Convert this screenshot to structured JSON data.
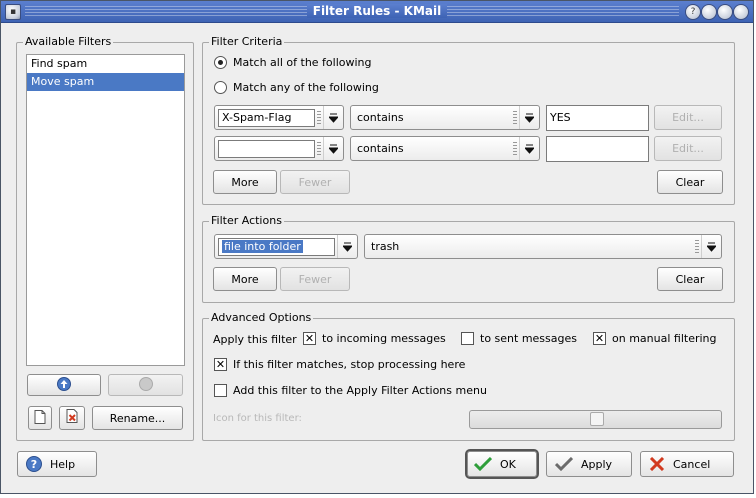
{
  "window": {
    "title": "Filter Rules - KMail"
  },
  "available_filters": {
    "label": "Available Filters",
    "items": [
      {
        "name": "Find spam",
        "selected": false
      },
      {
        "name": "Move spam",
        "selected": true
      }
    ],
    "rename_label": "Rename..."
  },
  "criteria": {
    "label": "Filter Criteria",
    "match_all": "Match all of the following",
    "match_any": "Match any of the following",
    "match_mode": "all",
    "rules": [
      {
        "field": "X-Spam-Flag",
        "function": "contains",
        "value": "YES",
        "edit_label": "Edit..."
      },
      {
        "field": "",
        "function": "contains",
        "value": "",
        "edit_label": "Edit..."
      }
    ],
    "more_label": "More",
    "fewer_label": "Fewer",
    "clear_label": "Clear"
  },
  "actions": {
    "label": "Filter Actions",
    "action": "file into folder",
    "target": "trash",
    "more_label": "More",
    "fewer_label": "Fewer",
    "clear_label": "Clear"
  },
  "advanced": {
    "label": "Advanced Options",
    "apply_label": "Apply this filter",
    "incoming_label": "to incoming messages",
    "incoming_checked": true,
    "sent_label": "to sent messages",
    "sent_checked": false,
    "manual_label": "on manual filtering",
    "manual_checked": true,
    "stop_label": "If this filter matches, stop processing here",
    "stop_checked": true,
    "menu_label": "Add this filter to the Apply Filter Actions menu",
    "menu_checked": false,
    "icon_label": "Icon for this filter:"
  },
  "footer": {
    "help_label": "Help",
    "ok_label": "OK",
    "apply_label": "Apply",
    "cancel_label": "Cancel"
  },
  "colors": {
    "title_bar": "#4a6fc2",
    "selection": "#4a79c5",
    "ok_check": "#2e9e3a",
    "cancel_x": "#d23a1f"
  }
}
